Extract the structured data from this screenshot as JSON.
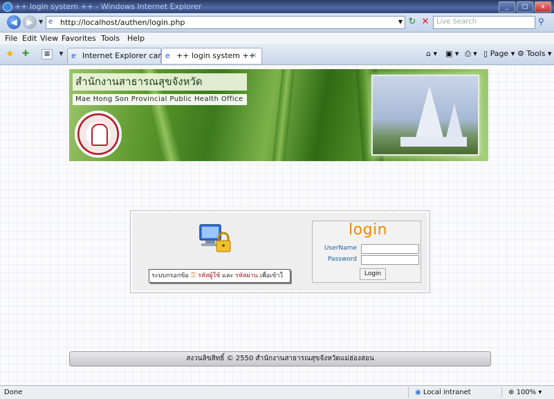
{
  "window": {
    "title": "++ login system ++ - Windows Internet Explorer",
    "min": "_",
    "max": "□",
    "close": "x"
  },
  "address": {
    "url": "http://localhost/authen/login.php",
    "search_placeholder": "Live Search"
  },
  "menu": [
    "File",
    "Edit",
    "View",
    "Favorites",
    "Tools",
    "Help"
  ],
  "tabs": [
    {
      "label": "Internet Explorer cannot...",
      "active": false
    },
    {
      "label": "++ login system ++",
      "active": true
    }
  ],
  "toolbar": {
    "page": "Page",
    "tools": "Tools"
  },
  "banner": {
    "thai_title": "สำนักงานสาธารณสุขจังหวัดแม่ฮ่องสอน",
    "english_title": "Mae Hong Son Provincial Public Health Office"
  },
  "login": {
    "heading": "login",
    "username_label": "UserName",
    "password_label": "Password",
    "username_value": "",
    "password_value": "",
    "button_label": "Login",
    "notice_pre": "ระบบกรอกข้อ",
    "notice_user": "รหัสผู้ใช้",
    "notice_and": "และ",
    "notice_pass": "รหัสผ่าน",
    "notice_post": "เพื่อเข้าใ"
  },
  "footer": {
    "copyright": "สงวนลิขสิทธิ์ © 2550 สำนักงานสาธารณสุขจังหวัดแม่ฮ่องสอน"
  },
  "status": {
    "text": "Done",
    "zone": "Local intranet",
    "zoom": "100%"
  },
  "colors": {
    "login_heading": "#ee8a00",
    "field_label": "#1f5fa0",
    "accent_red": "#9b1414"
  }
}
